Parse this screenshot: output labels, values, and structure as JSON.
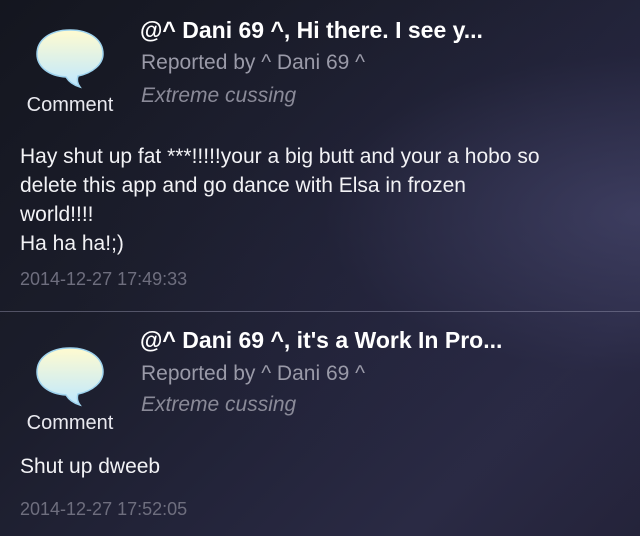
{
  "reports": [
    {
      "icon": "speech-bubble-icon",
      "comment_label": "Comment",
      "title": "@^ Dani 69 ^, Hi there. I see y...",
      "reported_by": "Reported by ^ Dani 69 ^",
      "category": "Extreme cussing",
      "body": [
        "Hay shut up fat ***!!!!!your a big butt and your a hobo so",
        "delete this app and go dance with Elsa in frozen",
        "world!!!!",
        "Ha ha ha!;)"
      ],
      "timestamp": "2014-12-27 17:49:33"
    },
    {
      "icon": "speech-bubble-icon",
      "comment_label": "Comment",
      "title": "@^ Dani 69 ^, it's a Work In Pro...",
      "reported_by": "Reported by ^ Dani 69 ^",
      "category": "Extreme cussing",
      "body": [
        "Shut up dweeb"
      ],
      "timestamp": "2014-12-27 17:52:05"
    }
  ],
  "colors": {
    "bubble_fill_top": "#fffbd0",
    "bubble_fill_bottom": "#bfe8ff",
    "title": "#ffffff",
    "secondary_text": "#9a9aa8",
    "timestamp": "#6e6e7e"
  }
}
